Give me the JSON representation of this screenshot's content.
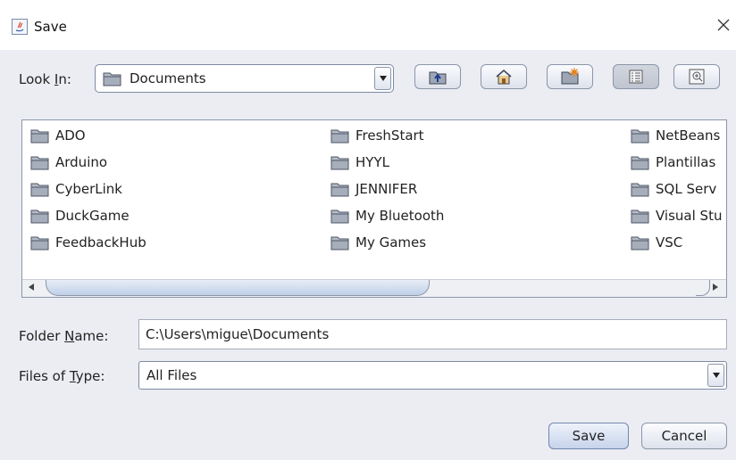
{
  "window": {
    "title": "Save",
    "close_label": "×"
  },
  "look_in": {
    "label_prefix": "Look ",
    "label_mnemonic": "I",
    "label_suffix": "n:",
    "value": "Documents"
  },
  "toolbar": {
    "buttons": [
      "up-one-level",
      "home",
      "new-folder",
      "list-view",
      "details-view"
    ],
    "active": "list-view"
  },
  "files": {
    "columns": [
      [
        "ADO",
        "Arduino",
        "CyberLink",
        "DuckGame",
        "FeedbackHub"
      ],
      [
        "FreshStart",
        "HYYL",
        "JENNIFER",
        "My Bluetooth",
        "My Games"
      ],
      [
        "NetBeans",
        "Plantillas",
        "SQL Serv",
        "Visual Stu",
        "VSC"
      ]
    ]
  },
  "folder_name": {
    "label_prefix": "Folder ",
    "label_mnemonic": "N",
    "label_suffix": "ame:",
    "value": "C:\\Users\\migue\\Documents"
  },
  "files_of_type": {
    "label_prefix": "Files of ",
    "label_mnemonic": "T",
    "label_suffix": "ype:",
    "value": "All Files"
  },
  "actions": {
    "save": "Save",
    "cancel": "Cancel"
  },
  "colors": {
    "dialog_bg": "#ebedf3",
    "accent": "#7086ad",
    "folder": "#a7aebb"
  }
}
